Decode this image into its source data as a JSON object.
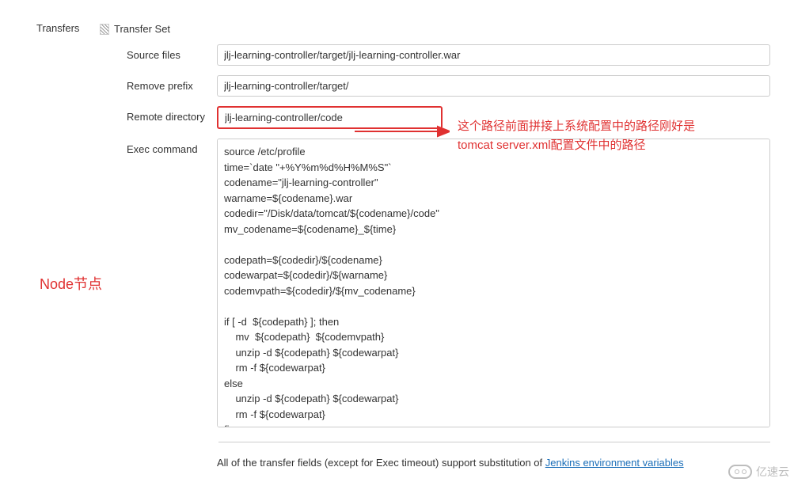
{
  "section": {
    "label": "Transfers",
    "transferSetLabel": "Transfer Set"
  },
  "fields": {
    "sourceFiles": {
      "label": "Source files",
      "value": "jlj-learning-controller/target/jlj-learning-controller.war"
    },
    "removePrefix": {
      "label": "Remove prefix",
      "value": "jlj-learning-controller/target/"
    },
    "remoteDirectory": {
      "label": "Remote directory",
      "value": "jlj-learning-controller/code"
    },
    "execCommand": {
      "label": "Exec command",
      "value": "source /etc/profile\ntime=`date \"+%Y%m%d%H%M%S\"`\ncodename=\"jlj-learning-controller\"\nwarname=${codename}.war\ncodedir=\"/Disk/data/tomcat/${codename}/code\"\nmv_codename=${codename}_${time}\n\ncodepath=${codedir}/${codename}\ncodewarpat=${codedir}/${warname}\ncodemvpath=${codedir}/${mv_codename}\n\nif [ -d  ${codepath} ]; then\n    mv  ${codepath}  ${codemvpath}\n    unzip -d ${codepath} ${codewarpat}\n    rm -f ${codewarpat}\nelse\n    unzip -d ${codepath} ${codewarpat}\n    rm -f ${codewarpat}\nfi"
    }
  },
  "annotations": {
    "nodeLabel": "Node节点",
    "redText": "这个路径前面拼接上系统配置中的路径刚好是tomcat server.xml配置文件中的路径"
  },
  "footer": {
    "text": "All of the transfer fields (except for Exec timeout) support substitution of ",
    "linkText": "Jenkins environment variables"
  },
  "watermark": {
    "text": "亿速云"
  }
}
